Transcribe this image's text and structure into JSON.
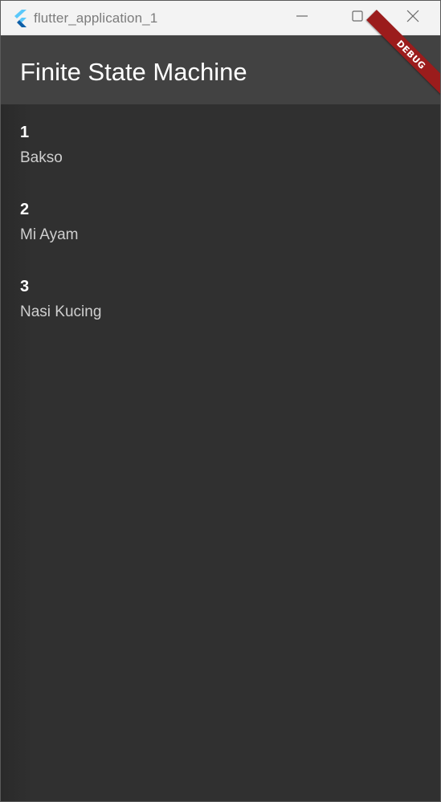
{
  "window": {
    "title": "flutter_application_1",
    "icon": "flutter-logo-icon",
    "controls": [
      "minimize-icon",
      "maximize-icon",
      "close-icon"
    ]
  },
  "appbar": {
    "title": "Finite State Machine"
  },
  "debug_banner": {
    "label": "DEBUG",
    "color": "#9b1c1c"
  },
  "list": {
    "items": [
      {
        "title": "1",
        "subtitle": "Bakso"
      },
      {
        "title": "2",
        "subtitle": "Mi Ayam"
      },
      {
        "title": "3",
        "subtitle": "Nasi Kucing"
      }
    ]
  },
  "colors": {
    "titlebar_bg": "#f3f3f3",
    "appbar_bg": "#424242",
    "body_bg": "#303030",
    "flutter_blue": "#42a5f5"
  }
}
